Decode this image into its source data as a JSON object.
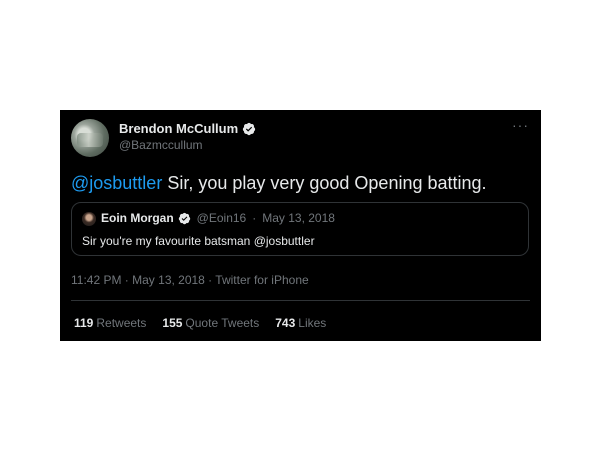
{
  "tweet": {
    "author": {
      "display_name": "Brendon McCullum",
      "handle": "@Bazmccullum",
      "verified": true
    },
    "more_icon": "more-options-icon",
    "text": {
      "mention": "@josbuttler",
      "body": " Sir, you play very good Opening batting."
    },
    "quoted_tweet": {
      "display_name": "Eoin Morgan",
      "handle": "@Eoin16",
      "separator": "·",
      "date": "May 13, 2018",
      "verified": true,
      "text": "Sir you're my favourite batsman @josbuttler"
    },
    "timestamp": "11:42 PM · May 13, 2018 · Twitter for iPhone",
    "stats": [
      {
        "count": "119",
        "label": "Retweets"
      },
      {
        "count": "155",
        "label": "Quote Tweets"
      },
      {
        "count": "743",
        "label": "Likes"
      }
    ],
    "colors": {
      "background": "#000000",
      "text": "#e7e9ea",
      "secondary": "#71767b",
      "accent": "#1d9bf0",
      "border": "#2f3336"
    }
  }
}
